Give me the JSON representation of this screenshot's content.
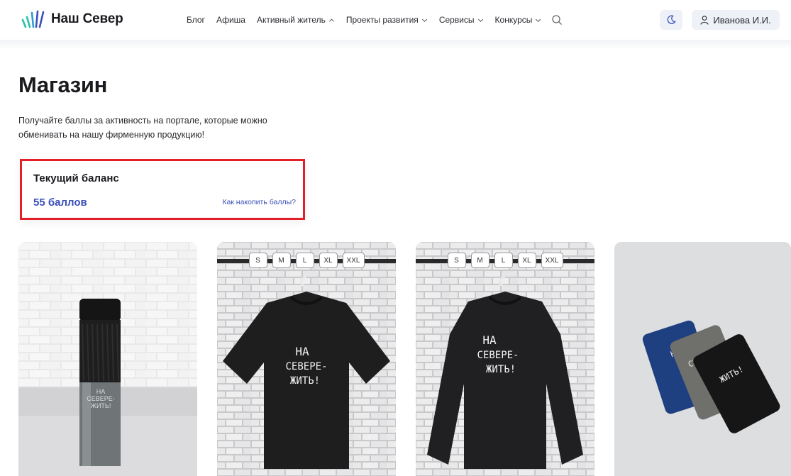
{
  "header": {
    "logo_text": "Наш Север",
    "nav": [
      {
        "label": "Блог",
        "chevron": null
      },
      {
        "label": "Афиша",
        "chevron": null
      },
      {
        "label": "Активный житель",
        "chevron": "up"
      },
      {
        "label": "Проекты развития",
        "chevron": "down"
      },
      {
        "label": "Сервисы",
        "chevron": "down"
      },
      {
        "label": "Конкурсы",
        "chevron": "down"
      }
    ],
    "icons": {
      "search": "search-icon",
      "theme": "moon-icon",
      "user": "user-icon"
    },
    "user_name": "Иванова И.И."
  },
  "page": {
    "title": "Магазин",
    "intro": "Получайте баллы за активность на портале, которые можно обменивать на нашу фирменную продукцию!"
  },
  "balance": {
    "title": "Текущий баланс",
    "value": "55 баллов",
    "link": "Как накопить баллы?"
  },
  "products": [
    {
      "kind": "thermos",
      "print": [
        "НА",
        "СЕВЕРЕ-",
        "ЖИТЬ!"
      ],
      "sizes": []
    },
    {
      "kind": "tshirt",
      "print": [
        "НА",
        "СЕВЕРЕ-",
        "ЖИТЬ!"
      ],
      "sizes": [
        "S",
        "M",
        "L",
        "XL",
        "XXL"
      ]
    },
    {
      "kind": "sweatshirt",
      "print": [
        "НА",
        "СЕВЕРЕ-",
        "ЖИТЬ!"
      ],
      "sizes": [
        "S",
        "M",
        "L",
        "XL",
        "XXL"
      ]
    },
    {
      "kind": "cardholders",
      "print": [
        "НА",
        "СЕВЕРЕ-",
        "ЖИТЬ!"
      ],
      "sizes": []
    }
  ],
  "colors": {
    "accent": "#3a4fb8",
    "highlight": "#e3202a",
    "button_bg": "#eef1f7"
  }
}
